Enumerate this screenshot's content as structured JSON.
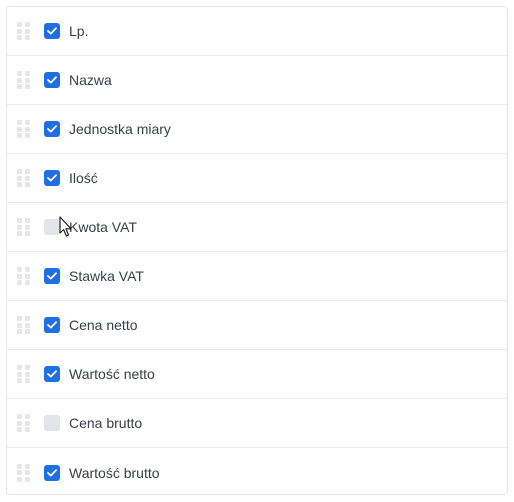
{
  "columns_list": {
    "items": [
      {
        "label": "Lp.",
        "checked": true
      },
      {
        "label": "Nazwa",
        "checked": true
      },
      {
        "label": "Jednostka miary",
        "checked": true
      },
      {
        "label": "Ilość",
        "checked": true
      },
      {
        "label": "Kwota VAT",
        "checked": false
      },
      {
        "label": "Stawka VAT",
        "checked": true
      },
      {
        "label": "Cena netto",
        "checked": true
      },
      {
        "label": "Wartość netto",
        "checked": true
      },
      {
        "label": "Cena brutto",
        "checked": false
      },
      {
        "label": "Wartość brutto",
        "checked": true
      }
    ]
  },
  "colors": {
    "checkbox_checked": "#1e6fe3",
    "checkbox_unchecked": "#e3e5e9",
    "handle": "#e4e6e9",
    "border": "#e3e6ea"
  },
  "icons": {
    "drag_handle": "drag-handle-icon",
    "check": "check-icon",
    "cursor": "mouse-pointer-icon"
  }
}
